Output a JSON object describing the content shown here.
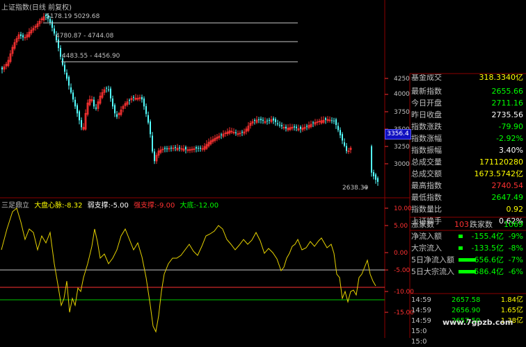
{
  "window": {
    "title": "上证指数(日线 前复权)"
  },
  "colors": {
    "up": "#ff3232",
    "down": "#54ffff",
    "green": "#00ff00",
    "red": "#ff3232",
    "yellow": "#ffff00",
    "white": "#ffffff",
    "grid": "#8b0000",
    "hline_white": "#c8c8c8",
    "hline_red": "#ff3232",
    "hline_green": "#00c800",
    "line": "#e6d200"
  },
  "price_axis": {
    "ticks": [
      "4250",
      "4000",
      "3750",
      "3500",
      "3250",
      "3000"
    ],
    "current_label": "3356.4"
  },
  "price_annotations": [
    {
      "text": "5178.19 5029.68"
    },
    {
      "text": "4780.87 - 4744.08"
    },
    {
      "text": "4483.55 - 4456.90"
    }
  ],
  "low_label": "2638.30",
  "indicator": {
    "name": "三足鼎立",
    "items": [
      {
        "label": "大盘心脉:",
        "value": "-8.32",
        "color": "#ffff00"
      },
      {
        "label": "弱支撑:",
        "value": "-5.00",
        "color": "#ffffff"
      },
      {
        "label": "强支撑:",
        "value": "-9.00",
        "color": "#ff3232"
      },
      {
        "label": "大底:",
        "value": "-12.00",
        "color": "#00ff00"
      }
    ],
    "axis_ticks": [
      "10.00",
      "5.00",
      "0.00",
      "-5.00",
      "-10.00",
      "-15.00"
    ]
  },
  "quote_panel": {
    "top_partial": {
      "label": "基金成交",
      "value": "318.3340亿"
    },
    "rows": [
      {
        "label": "最新指数",
        "value": "2655.66",
        "color": "#00ff00"
      },
      {
        "label": "今日开盘",
        "value": "2711.16",
        "color": "#00ff00"
      },
      {
        "label": "昨日收盘",
        "value": "2735.56",
        "color": "#ffffff"
      },
      {
        "label": "指数涨跌",
        "value": "-79.90",
        "color": "#00ff00"
      },
      {
        "label": "指数涨幅",
        "value": "-2.92%",
        "color": "#00ff00"
      },
      {
        "label": "指数振幅",
        "value": "3.40%",
        "color": "#ffffff"
      },
      {
        "label": "总成交量",
        "value": "171120280",
        "color": "#ffff00"
      },
      {
        "label": "总成交额",
        "value": "1673.5742亿",
        "color": "#ffff00"
      },
      {
        "label": "最高指数",
        "value": "2740.54",
        "color": "#ff3232"
      },
      {
        "label": "最低指数",
        "value": "2647.49",
        "color": "#00ff00"
      },
      {
        "label": "指数量比",
        "value": "0.92",
        "color": "#ffff00"
      },
      {
        "label": "上证换手",
        "value": "0.62%",
        "color": "#ffffff"
      }
    ],
    "breadth": {
      "up_label": "涨家数",
      "up_value": "103",
      "down_label": "跌家数",
      "down_value": "1069"
    },
    "flows": [
      {
        "label": "净流入额",
        "value": "-155.4亿",
        "pct": "-9%",
        "bar": 0.08
      },
      {
        "label": "大宗流入",
        "value": "-133.5亿",
        "pct": "-8%",
        "bar": 0.08
      },
      {
        "label": "5日净流入额",
        "value": "-656.6亿",
        "pct": "-7%",
        "bar": 0.45
      },
      {
        "label": "5日大宗流入",
        "value": "-586.4亿",
        "pct": "-6%",
        "bar": 0.45
      }
    ],
    "ticks": [
      {
        "time": "14:59",
        "price": "2657.58",
        "vol": "1.84亿"
      },
      {
        "time": "14:59",
        "price": "2656.90",
        "vol": "1.65亿"
      },
      {
        "time": "14:59",
        "price": "2657.50",
        "vol": "1.38亿"
      },
      {
        "time": "15:0",
        "price": "",
        "vol": ""
      },
      {
        "time": "15:0",
        "price": "",
        "vol": ""
      }
    ]
  },
  "watermark": "www.7gpzb.com"
}
